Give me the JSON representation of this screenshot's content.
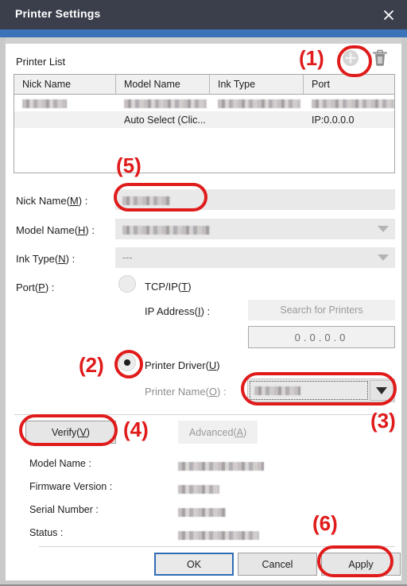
{
  "window": {
    "title": "Printer Settings",
    "close_icon": "close-icon",
    "accent_color": "#3b72b8",
    "titlebar_color": "#3b3f4b"
  },
  "printer_list": {
    "label": "Printer List",
    "add_icon": "plus-circle-icon",
    "delete_icon": "trash-icon",
    "columns": [
      "Nick Name",
      "Model Name",
      "Ink Type",
      "Port"
    ],
    "rows": [
      {
        "nick_name": "",
        "model_name": "",
        "ink_type": "",
        "port": "",
        "redacted": true,
        "selected": false
      },
      {
        "nick_name": "",
        "model_name": "Auto Select (Clic...",
        "ink_type": "",
        "port": "IP:0.0.0.0",
        "redacted": false,
        "selected": true
      }
    ]
  },
  "form": {
    "nick_name": {
      "label_prefix": "Nick Name(",
      "mnemonic": "M",
      "label_suffix": ") :",
      "value": "",
      "redacted": true
    },
    "model_name": {
      "label_prefix": "Model Name(",
      "mnemonic": "H",
      "label_suffix": ") :",
      "value": "",
      "redacted": true
    },
    "ink_type": {
      "label_prefix": "Ink Type(",
      "mnemonic": "N",
      "label_suffix": ") :",
      "value": "---",
      "redacted": false
    },
    "port": {
      "label_prefix": "Port(",
      "mnemonic": "P",
      "label_suffix": ") :"
    },
    "tcpip_radio": {
      "label_prefix": "TCP/IP(",
      "mnemonic": "T",
      "label_suffix": ")",
      "selected": false
    },
    "ip_address": {
      "label_prefix": "IP Address(",
      "mnemonic": "I",
      "label_suffix": ") :",
      "octets": [
        "0",
        "0",
        "0",
        "0"
      ],
      "separator": "."
    },
    "search_button": {
      "label": "Search for Printers",
      "disabled": true
    },
    "printer_driver_radio": {
      "label_prefix": "Printer Driver(",
      "mnemonic": "U",
      "label_suffix": ")",
      "selected": true
    },
    "printer_name": {
      "label_prefix": "Printer Name(",
      "mnemonic": "O",
      "label_suffix": ") :",
      "value": "",
      "redacted": true,
      "arrow_icon": "chevron-down-icon"
    }
  },
  "details": {
    "verify_button": {
      "label_prefix": "Verify(",
      "mnemonic": "V",
      "label_suffix": ")"
    },
    "advanced_button": {
      "label_prefix": "Advanced(",
      "mnemonic": "A",
      "label_suffix": ")",
      "disabled": true
    },
    "fields": [
      {
        "label": "Model Name :",
        "value": "",
        "redacted": true,
        "redact_width": 108
      },
      {
        "label": "Firmware Version :",
        "value": "",
        "redacted": true,
        "redact_width": 52
      },
      {
        "label": "Serial Number :",
        "value": "",
        "redacted": true,
        "redact_width": 60
      },
      {
        "label": "Status :",
        "value": "",
        "redacted": true,
        "redact_width": 102
      }
    ]
  },
  "footer": {
    "ok_label": "OK",
    "cancel_label": "Cancel",
    "apply_label": "Apply"
  },
  "annotations": [
    {
      "number": "(1)",
      "target": "add-printer-button"
    },
    {
      "number": "(2)",
      "target": "printer-driver-radio"
    },
    {
      "number": "(3)",
      "target": "printer-name-combo"
    },
    {
      "number": "(4)",
      "target": "verify-button"
    },
    {
      "number": "(5)",
      "target": "nick-name-field"
    },
    {
      "number": "(6)",
      "target": "apply-button"
    }
  ],
  "annotation_color": "#e01b1b"
}
